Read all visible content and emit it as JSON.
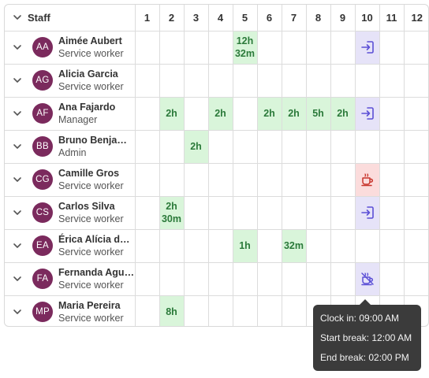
{
  "header": {
    "staff_label": "Staff",
    "days": [
      "1",
      "2",
      "3",
      "4",
      "5",
      "6",
      "7",
      "8",
      "9",
      "10",
      "11",
      "12"
    ]
  },
  "rows": [
    {
      "initials": "AA",
      "name": "Aimée Aubert",
      "role": "Service worker",
      "cells": {
        "5": {
          "text": "12h 32m",
          "kind": "green"
        },
        "10": {
          "icon": "clock-in-icon",
          "kind": "purple"
        }
      }
    },
    {
      "initials": "AG",
      "name": "Alicia Garcia",
      "role": "Service worker",
      "cells": {}
    },
    {
      "initials": "AF",
      "name": "Ana Fajardo",
      "role": "Manager",
      "cells": {
        "2": {
          "text": "2h",
          "kind": "green"
        },
        "4": {
          "text": "2h",
          "kind": "green"
        },
        "6": {
          "text": "2h",
          "kind": "green"
        },
        "7": {
          "text": "2h",
          "kind": "green"
        },
        "8": {
          "text": "5h",
          "kind": "green"
        },
        "9": {
          "text": "2h",
          "kind": "green"
        },
        "10": {
          "icon": "clock-in-icon",
          "kind": "purple"
        }
      }
    },
    {
      "initials": "BB",
      "name": "Bruno Benjamim",
      "role": "Admin",
      "cells": {
        "3": {
          "text": "2h",
          "kind": "green"
        }
      }
    },
    {
      "initials": "CG",
      "name": "Camille Gros",
      "role": "Service worker",
      "cells": {
        "10": {
          "icon": "coffee-break-icon",
          "kind": "red"
        }
      }
    },
    {
      "initials": "CS",
      "name": "Carlos Silva",
      "role": "Service worker",
      "cells": {
        "2": {
          "text": "2h 30m",
          "kind": "green"
        },
        "10": {
          "icon": "clock-in-icon",
          "kind": "purple"
        }
      }
    },
    {
      "initials": "EA",
      "name": "Érica Alícia de…",
      "role": "Service worker",
      "cells": {
        "5": {
          "text": "1h",
          "kind": "green"
        },
        "7": {
          "text": "32m",
          "kind": "green"
        }
      }
    },
    {
      "initials": "FA",
      "name": "Fernanda Aguiar",
      "role": "Service worker",
      "cells": {
        "10": {
          "icon": "break-ended-icon",
          "kind": "purple"
        }
      }
    },
    {
      "initials": "MP",
      "name": "Maria Pereira",
      "role": "Service worker",
      "cells": {
        "2": {
          "text": "8h",
          "kind": "green"
        }
      }
    }
  ],
  "tooltip": {
    "lines": [
      "Clock in: 09:00 AM",
      "Start break: 12:00 AM",
      "End break: 02:00 PM"
    ]
  },
  "colors": {
    "avatar": "#7b2a5d",
    "worked_bg": "#d9f5da",
    "worked_text": "#2b7a3a",
    "clock_bg": "#e6e3f8",
    "clock_icon": "#5b4fd6",
    "break_bg": "#fbdcdc",
    "break_icon": "#c8352c",
    "tooltip_bg": "#3b3b3b"
  }
}
